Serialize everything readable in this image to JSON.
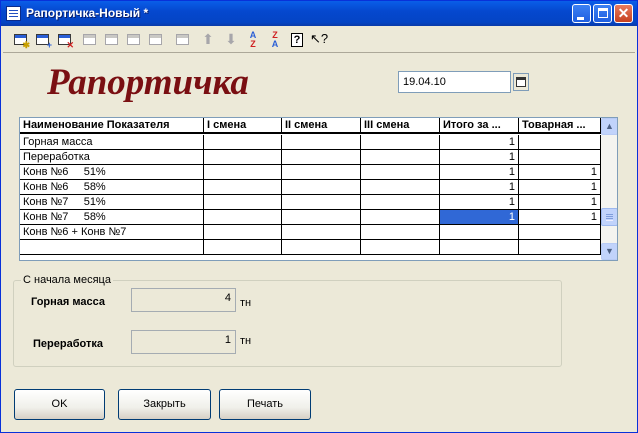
{
  "window": {
    "title": "Рапортичка-Новый *"
  },
  "toolbar": {
    "items": [
      {
        "name": "add-row",
        "icon": "table-add-icon",
        "enabled": true
      },
      {
        "name": "copy-row",
        "icon": "table-copy-icon",
        "enabled": true
      },
      {
        "name": "delete-row",
        "icon": "table-delete-icon",
        "enabled": true
      },
      {
        "name": "tool-4",
        "icon": "table-disabled-icon",
        "enabled": false
      },
      {
        "name": "tool-5",
        "icon": "table-disabled-icon",
        "enabled": false
      },
      {
        "name": "tool-6",
        "icon": "table-disabled-icon",
        "enabled": false
      },
      {
        "name": "tool-7",
        "icon": "table-disabled-icon",
        "enabled": false
      },
      {
        "name": "tool-8",
        "icon": "table-disabled-icon",
        "enabled": false
      },
      {
        "name": "move-up",
        "icon": "arrow-up-icon",
        "enabled": false
      },
      {
        "name": "move-down",
        "icon": "arrow-down-icon",
        "enabled": false
      },
      {
        "name": "sort-asc",
        "icon": "sort-az-icon",
        "enabled": true
      },
      {
        "name": "sort-desc",
        "icon": "sort-za-icon",
        "enabled": true
      },
      {
        "name": "help",
        "icon": "help-icon",
        "enabled": true
      },
      {
        "name": "context-help",
        "icon": "pointer-help-icon",
        "enabled": true
      }
    ]
  },
  "header": {
    "title": "Рапортичка",
    "date": "19.04.10"
  },
  "table": {
    "columns": [
      "Наименование Показателя",
      "I смена",
      "II смена",
      "III смена",
      "Итого за ...",
      "Товарная ..."
    ],
    "rows": [
      [
        "Горная масса",
        "",
        "",
        "",
        "1",
        ""
      ],
      [
        "Переработка",
        "",
        "",
        "",
        "1",
        ""
      ],
      [
        "Конв №6     51%",
        "",
        "",
        "",
        "1",
        "1"
      ],
      [
        "Конв №6     58%",
        "",
        "",
        "",
        "1",
        "1"
      ],
      [
        "Конв №7     51%",
        "",
        "",
        "",
        "1",
        "1"
      ],
      [
        "Конв №7     58%",
        "",
        "",
        "",
        "1",
        "1"
      ],
      [
        "Конв №6 + Конв №7",
        "",
        "",
        "",
        "",
        ""
      ],
      [
        "",
        "",
        "",
        "",
        "",
        ""
      ]
    ],
    "selected_row": 5,
    "selected_col": 4
  },
  "summary": {
    "group_title": "С начала месяца",
    "items": [
      {
        "label": "Горная масса",
        "value": "4",
        "unit": "тн"
      },
      {
        "label": "Переработка",
        "value": "1",
        "unit": "тн"
      }
    ]
  },
  "buttons": {
    "ok": "OK",
    "close": "Закрыть",
    "print": "Печать"
  },
  "colors": {
    "title_color": "#7a0f12",
    "selection": "#3068d6",
    "titlebar": "#0548cf"
  }
}
